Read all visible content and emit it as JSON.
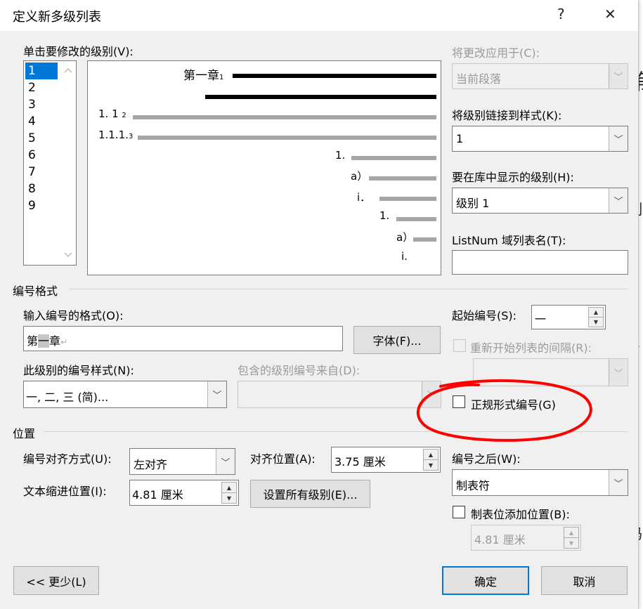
{
  "window": {
    "title": "定义新多级列表",
    "help": "?",
    "close": "✕"
  },
  "levels": {
    "label": "单击要修改的级别(V):",
    "items": [
      "1",
      "2",
      "3",
      "4",
      "5",
      "6",
      "7",
      "8",
      "9"
    ],
    "selected": "1"
  },
  "preview": {
    "line1_text": "第一章",
    "line1_num": "1",
    "line3_text": "1. 1",
    "line3_num": "2",
    "line4_text": "1.1.1.",
    "line4_num": "3",
    "l5": "1.",
    "l6": "a）",
    "l7": "i．",
    "l8": "1.",
    "l9": "a）",
    "l10": "i."
  },
  "apply_to": {
    "label": "将更改应用于(C):",
    "value": "当前段落"
  },
  "link_style": {
    "label": "将级别链接到样式(K):",
    "value": "1"
  },
  "gallery_level": {
    "label": "要在库中显示的级别(H):",
    "value": "级别 1"
  },
  "listnum": {
    "label": "ListNum 域列表名(T):",
    "value": ""
  },
  "number_format": {
    "group": "编号格式",
    "format_label": "输入编号的格式(O):",
    "format_prefix": "第",
    "format_highlight": "一",
    "format_suffix": "章",
    "paragraph_mark": "↵",
    "font_button": "字体(F)...",
    "start_label": "起始编号(S):",
    "start_value": "一",
    "restart_label": "重新开始列表的间隔(R):",
    "style_label": "此级别的编号样式(N):",
    "style_value": "一, 二, 三 (简)...",
    "include_label": "包含的级别编号来自(D):",
    "legal_label": "正规形式编号(G)"
  },
  "position": {
    "group": "位置",
    "align_label": "编号对齐方式(U):",
    "align_value": "左对齐",
    "at_label": "对齐位置(A):",
    "at_value": "3.75 厘米",
    "indent_label": "文本缩进位置(I):",
    "indent_value": "4.81 厘米",
    "set_all": "设置所有级别(E)...",
    "follow_label": "编号之后(W):",
    "follow_value": "制表符",
    "tab_label": "制表位添加位置(B):",
    "tab_value": "4.81 厘米"
  },
  "buttons": {
    "less": "<< 更少(L)",
    "ok": "确定",
    "cancel": "取消"
  },
  "background_doc": {
    "c1": "第",
    "c2": "制",
    "c3": "]",
    "c4": "...",
    "c5": "码"
  },
  "annotation": {
    "color": "#ff0000"
  }
}
